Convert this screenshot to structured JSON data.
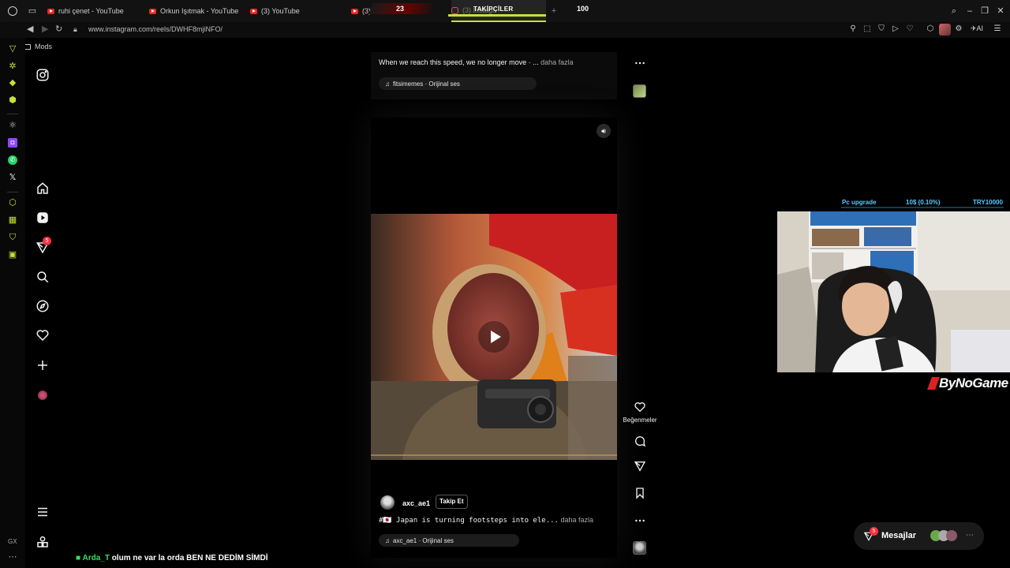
{
  "browser": {
    "tabs": [
      {
        "label": "ruhi çenet - YouTube",
        "icon": "youtube-icon"
      },
      {
        "label": "Orkun Işıtmak - YouTube",
        "icon": "youtube-icon"
      },
      {
        "label": "(3) YouTube",
        "icon": "youtube-icon"
      },
      {
        "label": "(3) Ins",
        "icon": "youtube-icon"
      },
      {
        "label": "(3) Instagr",
        "icon": "instagram-icon"
      }
    ],
    "url": "www.instagram.com/reels/DWHF8mjiNFO/",
    "bookmark_folder": "Mods",
    "gx_label": "GX"
  },
  "stream_overlay": {
    "counter_left": "23",
    "followers_title": "TAKİPÇİLER",
    "counter_right": "100",
    "goal_label": "Pc upgrade",
    "goal_progress": "10$ (0.10%)",
    "goal_target": "TRY10000",
    "channel_logo": "ByNoGame",
    "chat_user": "Arda_T",
    "chat_message": "olum ne var la orda BEN NE DEDİM SİMDİ"
  },
  "instagram": {
    "nav_badge": "5",
    "reel_top": {
      "caption": "When we reach this speed, we no longer move · ...",
      "more": "daha fazla",
      "audio": "fitsimemes · Orijinal ses"
    },
    "reel_main": {
      "username": "axc_ae1",
      "follow_label": "Takip Et",
      "caption": "#🇯🇵 Japan is turning footsteps into ele...",
      "more": "daha fazla",
      "audio": "axc_ae1 · Orijinal ses"
    },
    "likes_label": "Beğenmeler",
    "messages": {
      "label": "Mesajlar",
      "badge": "5"
    }
  },
  "colors": {
    "accent": "#c6e03a",
    "goal_text": "#5ac8ff",
    "youtube_red": "#ff1f1f",
    "notification_red": "#ff3040"
  }
}
